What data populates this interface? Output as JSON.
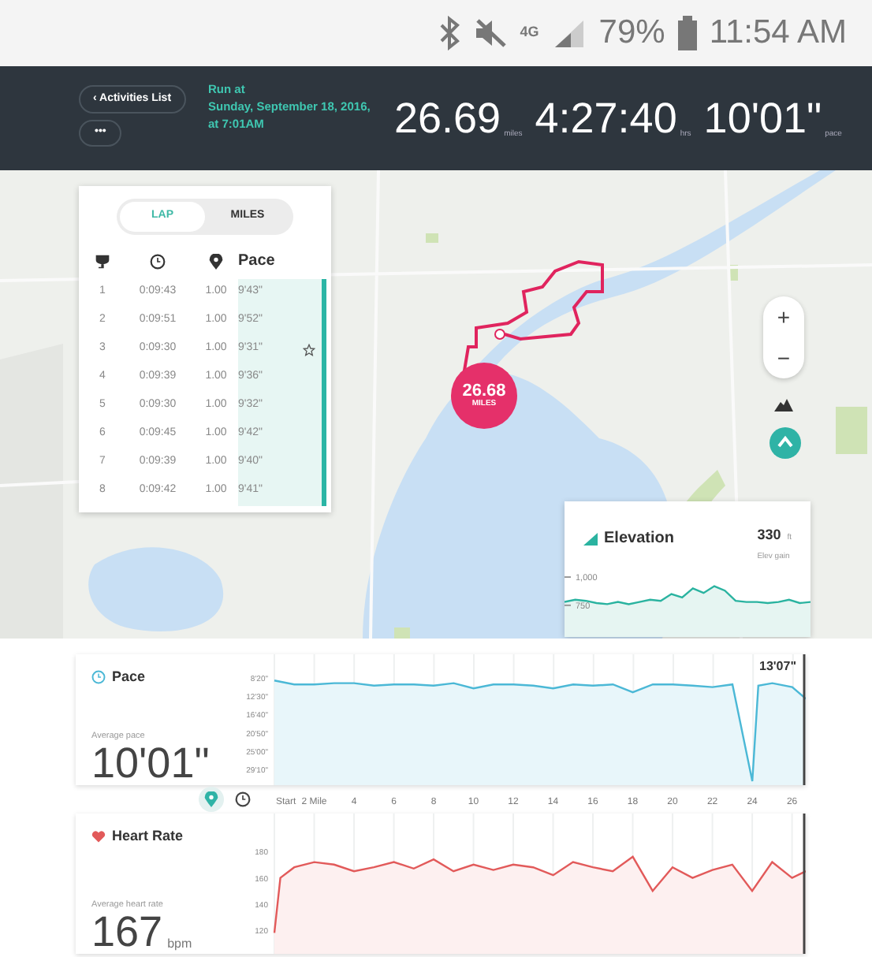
{
  "status_bar": {
    "network": "4G",
    "battery": "79%",
    "time": "11:54 AM"
  },
  "header": {
    "back_button": {
      "icon": "‹",
      "label": "Activities List"
    },
    "more_button": "•••",
    "title_lines": [
      "Run at",
      "Sunday, September 18, 2016,",
      "at 7:01AM"
    ],
    "stats": [
      {
        "value": "26.69",
        "unit": "miles"
      },
      {
        "value": "4:27:40",
        "unit": "hrs"
      },
      {
        "value": "10'01\"",
        "unit": "pace"
      }
    ]
  },
  "laps": {
    "tabs": [
      {
        "label": "LAP",
        "selected": true
      },
      {
        "label": "MILES",
        "selected": false
      }
    ],
    "pace_heading": "Pace",
    "rows": [
      {
        "lap": "1",
        "time": "0:09:43",
        "distance": "1.00",
        "pace": "9'43\"",
        "best": false
      },
      {
        "lap": "2",
        "time": "0:09:51",
        "distance": "1.00",
        "pace": "9'52\"",
        "best": false
      },
      {
        "lap": "3",
        "time": "0:09:30",
        "distance": "1.00",
        "pace": "9'31\"",
        "best": true
      },
      {
        "lap": "4",
        "time": "0:09:39",
        "distance": "1.00",
        "pace": "9'36\"",
        "best": false
      },
      {
        "lap": "5",
        "time": "0:09:30",
        "distance": "1.00",
        "pace": "9'32\"",
        "best": false
      },
      {
        "lap": "6",
        "time": "0:09:45",
        "distance": "1.00",
        "pace": "9'42\"",
        "best": false
      },
      {
        "lap": "7",
        "time": "0:09:39",
        "distance": "1.00",
        "pace": "9'40\"",
        "best": false
      },
      {
        "lap": "8",
        "time": "0:09:42",
        "distance": "1.00",
        "pace": "9'41\"",
        "best": false
      }
    ]
  },
  "map": {
    "marker": {
      "value": "26.68",
      "unit": "MILES"
    },
    "zoom_in": "+",
    "zoom_out": "−"
  },
  "elevation": {
    "value": "330",
    "unit": "ft",
    "caption": "Elev gain",
    "chart_data": {
      "type": "area",
      "ylim": [
        470,
        1670
      ],
      "yticks": [
        {
          "value": 1000,
          "label": "1,000"
        },
        {
          "value": 750,
          "label": "750"
        }
      ],
      "series": [
        {
          "name": "Elevation",
          "color": "#2ab3a0",
          "values": [
            780,
            800,
            790,
            770,
            760,
            780,
            760,
            780,
            800,
            790,
            850,
            820,
            900,
            860,
            920,
            880,
            790,
            780,
            780,
            770,
            780,
            800,
            770,
            780
          ]
        }
      ]
    }
  },
  "pace": {
    "caption": "Average pace",
    "value": "10'01\"",
    "y_axis_labels": [
      "8'20\"",
      "12'30\"",
      "16'40\"",
      "20'50\"",
      "25'00\"",
      "29'10\""
    ],
    "title": "Pace",
    "end_value": "13'07\""
  },
  "axis_toggle": [
    {
      "kind": "distance",
      "selected": true
    },
    {
      "kind": "time",
      "selected": false
    }
  ],
  "heart_rate": {
    "caption": "Average heart rate",
    "value": "167",
    "unit": "bpm",
    "chart_data": {
      "type": "area",
      "x": [
        0,
        0.3,
        1,
        2,
        3,
        4,
        5,
        6,
        7,
        8,
        9,
        10,
        11,
        12,
        13,
        14,
        15,
        16,
        17,
        18,
        19,
        20,
        21,
        22,
        23,
        24,
        25,
        26,
        26.69
      ],
      "xlim": [
        0,
        26.69
      ],
      "ylim": [
        102,
        209
      ],
      "grid": true,
      "xticks": [
        {
          "value": 0,
          "label": "Start"
        },
        {
          "value": 2,
          "label": "2 Mile"
        },
        4,
        6,
        8,
        10,
        12,
        14,
        16,
        18,
        20,
        22,
        24,
        26
      ],
      "yticks": [
        180,
        160,
        140,
        120
      ],
      "series": [
        {
          "name": "Heart Rate",
          "color": "#e25a5a",
          "values": [
            118,
            160,
            168,
            172,
            170,
            165,
            168,
            172,
            167,
            174,
            165,
            170,
            166,
            170,
            168,
            162,
            172,
            168,
            165,
            176,
            150,
            168,
            160,
            166,
            170,
            150,
            172,
            160,
            165
          ]
        }
      ]
    }
  }
}
